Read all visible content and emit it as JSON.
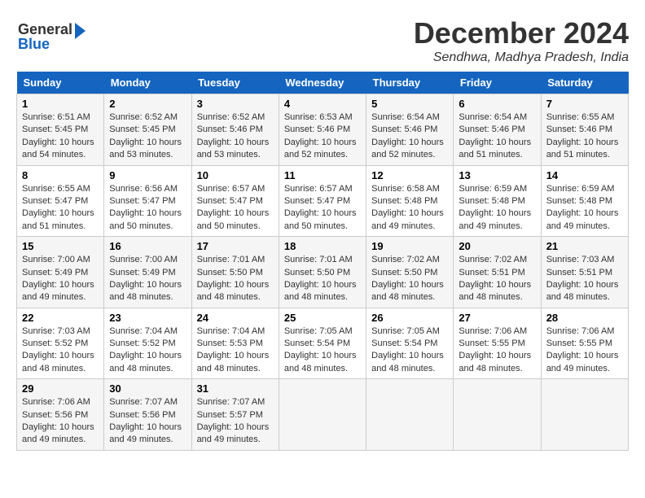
{
  "header": {
    "logo_line1": "General",
    "logo_line2": "Blue",
    "month": "December 2024",
    "location": "Sendhwa, Madhya Pradesh, India"
  },
  "weekdays": [
    "Sunday",
    "Monday",
    "Tuesday",
    "Wednesday",
    "Thursday",
    "Friday",
    "Saturday"
  ],
  "weeks": [
    [
      {
        "day": "1",
        "sunrise": "6:51 AM",
        "sunset": "5:45 PM",
        "daylight": "10 hours and 54 minutes."
      },
      {
        "day": "2",
        "sunrise": "6:52 AM",
        "sunset": "5:45 PM",
        "daylight": "10 hours and 53 minutes."
      },
      {
        "day": "3",
        "sunrise": "6:52 AM",
        "sunset": "5:46 PM",
        "daylight": "10 hours and 53 minutes."
      },
      {
        "day": "4",
        "sunrise": "6:53 AM",
        "sunset": "5:46 PM",
        "daylight": "10 hours and 52 minutes."
      },
      {
        "day": "5",
        "sunrise": "6:54 AM",
        "sunset": "5:46 PM",
        "daylight": "10 hours and 52 minutes."
      },
      {
        "day": "6",
        "sunrise": "6:54 AM",
        "sunset": "5:46 PM",
        "daylight": "10 hours and 51 minutes."
      },
      {
        "day": "7",
        "sunrise": "6:55 AM",
        "sunset": "5:46 PM",
        "daylight": "10 hours and 51 minutes."
      }
    ],
    [
      {
        "day": "8",
        "sunrise": "6:55 AM",
        "sunset": "5:47 PM",
        "daylight": "10 hours and 51 minutes."
      },
      {
        "day": "9",
        "sunrise": "6:56 AM",
        "sunset": "5:47 PM",
        "daylight": "10 hours and 50 minutes."
      },
      {
        "day": "10",
        "sunrise": "6:57 AM",
        "sunset": "5:47 PM",
        "daylight": "10 hours and 50 minutes."
      },
      {
        "day": "11",
        "sunrise": "6:57 AM",
        "sunset": "5:47 PM",
        "daylight": "10 hours and 50 minutes."
      },
      {
        "day": "12",
        "sunrise": "6:58 AM",
        "sunset": "5:48 PM",
        "daylight": "10 hours and 49 minutes."
      },
      {
        "day": "13",
        "sunrise": "6:59 AM",
        "sunset": "5:48 PM",
        "daylight": "10 hours and 49 minutes."
      },
      {
        "day": "14",
        "sunrise": "6:59 AM",
        "sunset": "5:48 PM",
        "daylight": "10 hours and 49 minutes."
      }
    ],
    [
      {
        "day": "15",
        "sunrise": "7:00 AM",
        "sunset": "5:49 PM",
        "daylight": "10 hours and 49 minutes."
      },
      {
        "day": "16",
        "sunrise": "7:00 AM",
        "sunset": "5:49 PM",
        "daylight": "10 hours and 48 minutes."
      },
      {
        "day": "17",
        "sunrise": "7:01 AM",
        "sunset": "5:50 PM",
        "daylight": "10 hours and 48 minutes."
      },
      {
        "day": "18",
        "sunrise": "7:01 AM",
        "sunset": "5:50 PM",
        "daylight": "10 hours and 48 minutes."
      },
      {
        "day": "19",
        "sunrise": "7:02 AM",
        "sunset": "5:50 PM",
        "daylight": "10 hours and 48 minutes."
      },
      {
        "day": "20",
        "sunrise": "7:02 AM",
        "sunset": "5:51 PM",
        "daylight": "10 hours and 48 minutes."
      },
      {
        "day": "21",
        "sunrise": "7:03 AM",
        "sunset": "5:51 PM",
        "daylight": "10 hours and 48 minutes."
      }
    ],
    [
      {
        "day": "22",
        "sunrise": "7:03 AM",
        "sunset": "5:52 PM",
        "daylight": "10 hours and 48 minutes."
      },
      {
        "day": "23",
        "sunrise": "7:04 AM",
        "sunset": "5:52 PM",
        "daylight": "10 hours and 48 minutes."
      },
      {
        "day": "24",
        "sunrise": "7:04 AM",
        "sunset": "5:53 PM",
        "daylight": "10 hours and 48 minutes."
      },
      {
        "day": "25",
        "sunrise": "7:05 AM",
        "sunset": "5:54 PM",
        "daylight": "10 hours and 48 minutes."
      },
      {
        "day": "26",
        "sunrise": "7:05 AM",
        "sunset": "5:54 PM",
        "daylight": "10 hours and 48 minutes."
      },
      {
        "day": "27",
        "sunrise": "7:06 AM",
        "sunset": "5:55 PM",
        "daylight": "10 hours and 48 minutes."
      },
      {
        "day": "28",
        "sunrise": "7:06 AM",
        "sunset": "5:55 PM",
        "daylight": "10 hours and 49 minutes."
      }
    ],
    [
      {
        "day": "29",
        "sunrise": "7:06 AM",
        "sunset": "5:56 PM",
        "daylight": "10 hours and 49 minutes."
      },
      {
        "day": "30",
        "sunrise": "7:07 AM",
        "sunset": "5:56 PM",
        "daylight": "10 hours and 49 minutes."
      },
      {
        "day": "31",
        "sunrise": "7:07 AM",
        "sunset": "5:57 PM",
        "daylight": "10 hours and 49 minutes."
      },
      null,
      null,
      null,
      null
    ]
  ]
}
